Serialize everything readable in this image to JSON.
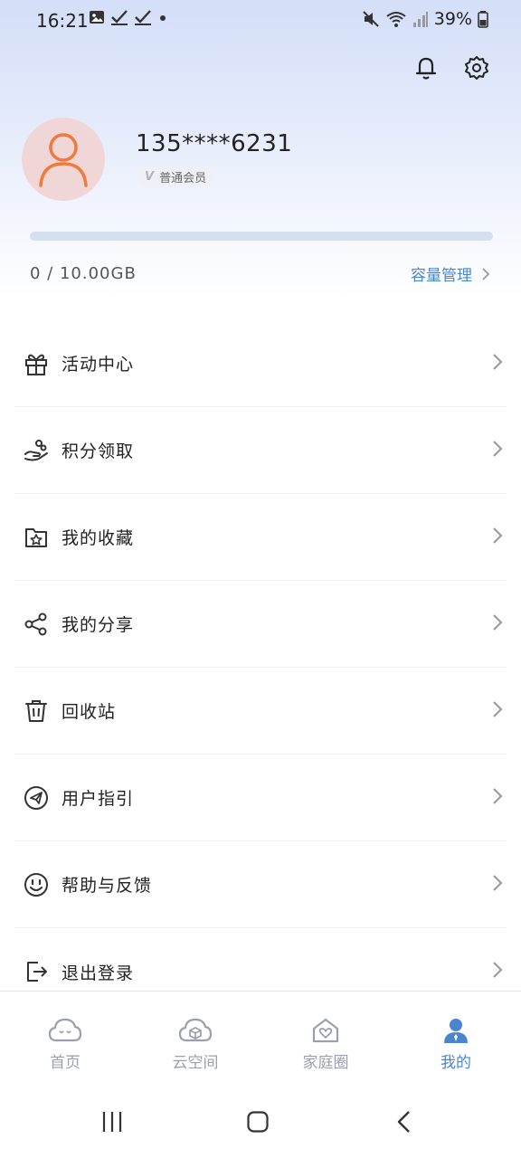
{
  "status": {
    "time": "16:21",
    "battery": "39%"
  },
  "profile": {
    "phone": "135****6231",
    "member_v": "V",
    "member_level": "普通会员"
  },
  "storage": {
    "used_text": "0 / 10.00GB",
    "used_fraction": 0,
    "manage_label": "容量管理"
  },
  "menu": [
    {
      "label": "活动中心",
      "icon": "gift-icon"
    },
    {
      "label": "积分领取",
      "icon": "coin-hand-icon"
    },
    {
      "label": "我的收藏",
      "icon": "star-folder-icon"
    },
    {
      "label": "我的分享",
      "icon": "share-icon"
    },
    {
      "label": "回收站",
      "icon": "trash-icon"
    },
    {
      "label": "用户指引",
      "icon": "paper-plane-icon"
    },
    {
      "label": "帮助与反馈",
      "icon": "smile-icon"
    },
    {
      "label": "退出登录",
      "icon": "logout-icon"
    }
  ],
  "tabs": [
    {
      "label": "首页",
      "icon": "cloud-face-icon",
      "active": false
    },
    {
      "label": "云空间",
      "icon": "cloud-box-icon",
      "active": false
    },
    {
      "label": "家庭圈",
      "icon": "house-heart-icon",
      "active": false
    },
    {
      "label": "我的",
      "icon": "person-icon",
      "active": true
    }
  ],
  "colors": {
    "accent": "#4a86d0",
    "avatar_bg": "#f1d6d8",
    "avatar_fg": "#f07a3e",
    "hero_top": "#d3def8"
  }
}
